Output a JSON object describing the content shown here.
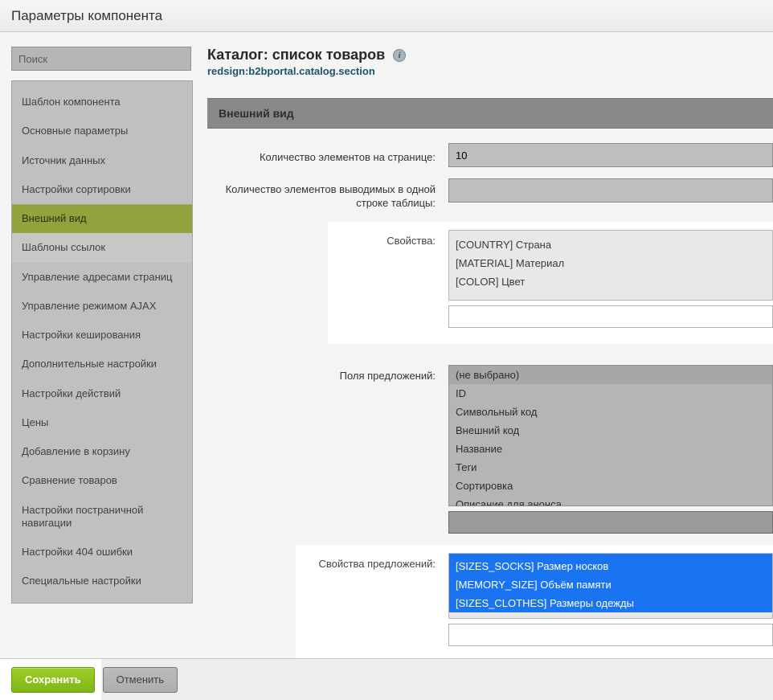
{
  "title": "Параметры компонента",
  "search_placeholder": "Поиск",
  "sidebar": {
    "items": [
      "Шаблон компонента",
      "Основные параметры",
      "Источник данных",
      "Настройки сортировки",
      "Внешний вид",
      "Шаблоны ссылок",
      "Управление адресами страниц",
      "Управление режимом AJAX",
      "Настройки кеширования",
      "Дополнительные настройки",
      "Настройки действий",
      "Цены",
      "Добавление в корзину",
      "Сравнение товаров",
      "Настройки постраничной навигации",
      "Настройки 404 ошибки",
      "Специальные настройки"
    ],
    "active_index": 4
  },
  "header": {
    "title": "Каталог: список товаров",
    "subtitle": "redsign:b2bportal.catalog.section"
  },
  "section_title": "Внешний вид",
  "fields": {
    "per_page": {
      "label": "Количество элементов на странице:",
      "value": "10"
    },
    "per_row": {
      "label": "Количество элементов выводимых в одной строке таблицы:",
      "value": ""
    },
    "properties": {
      "label": "Свойства:",
      "options": [
        "[COUNTRY] Страна",
        "[MATERIAL] Материал",
        "[COLOR] Цвет"
      ]
    },
    "offer_fields": {
      "label": "Поля предложений:",
      "options": [
        "(не выбрано)",
        "ID",
        "Символьный код",
        "Внешний код",
        "Название",
        "Теги",
        "Сортировка",
        "Описание для анонса"
      ],
      "selected_index": 0
    },
    "offer_properties": {
      "label": "Свойства предложений:",
      "options": [
        "[SIZES_SOCKS] Размер носков",
        "[MEMORY_SIZE] Объём памяти",
        "[SIZES_CLOTHES] Размеры одежды"
      ],
      "selected_indices": [
        0,
        1,
        2
      ]
    }
  },
  "buttons": {
    "save": "Сохранить",
    "cancel": "Отменить"
  }
}
